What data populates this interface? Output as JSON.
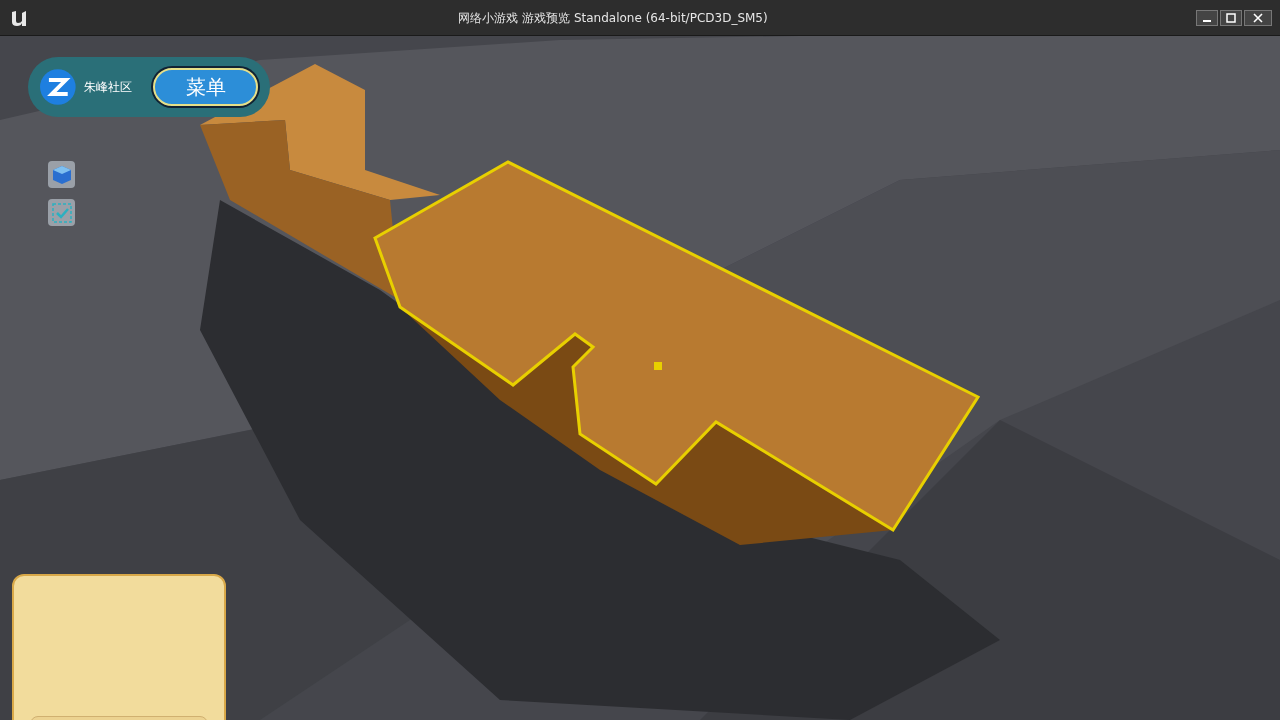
{
  "window": {
    "title": "网络小游戏 游戏预览 Standalone (64-bit/PCD3D_SM5)"
  },
  "hud": {
    "community_label": "朱峰社区",
    "menu_button": "菜单"
  }
}
